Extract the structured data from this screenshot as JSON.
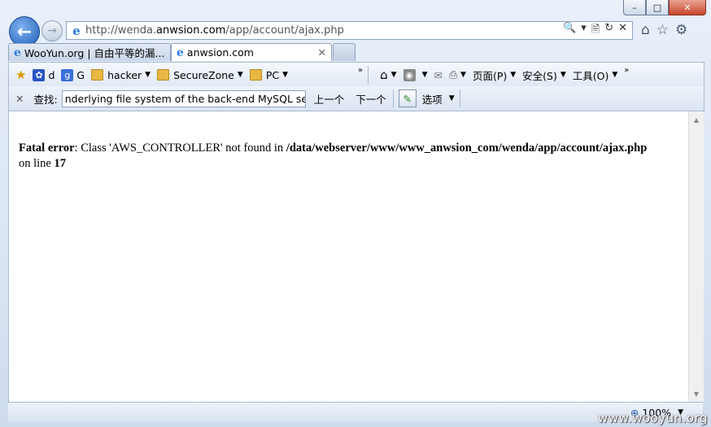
{
  "window": {
    "caption": {
      "minimize": "–",
      "maximize": "□",
      "close": "✕"
    }
  },
  "nav": {
    "back_icon": "arrow-left-icon",
    "forward_icon": "arrow-right-icon",
    "address": {
      "prefix": "http://wenda.",
      "domain": "anwsion.com",
      "path": "/app/account/ajax.php"
    },
    "address_tools": [
      "🔍",
      "▾",
      "🗎",
      "↻",
      "✕"
    ],
    "right_icons": [
      "⌂",
      "☆",
      "⚙"
    ]
  },
  "tabs": [
    {
      "label": "WooYun.org | 自由平等的漏...",
      "active": false
    },
    {
      "label": "anwsion.com",
      "active": true,
      "close": "✕"
    }
  ],
  "favorites_bar": {
    "items": [
      {
        "label": "d"
      },
      {
        "label": "G"
      },
      {
        "label": "hacker"
      },
      {
        "label": "SecureZone"
      },
      {
        "label": "PC"
      }
    ],
    "overflow": "»",
    "command_bar": {
      "page_menu": "页面(P)",
      "safety_menu": "安全(S)",
      "tools_menu": "工具(O)",
      "overflow": "»"
    }
  },
  "find_bar": {
    "close": "✕",
    "label": "查找:",
    "value": "nderlying file system of the back-end MySQL serv",
    "previous": "上一个",
    "next": "下一个",
    "options": "选项"
  },
  "page": {
    "error_label": "Fatal error",
    "error_message": ": Class 'AWS_CONTROLLER' not found in ",
    "error_path": "/data/webserver/www/www_anwsion_com/wenda/app/account/ajax.php",
    "line_text": " on line ",
    "line_number": "17"
  },
  "status_bar": {
    "zoom": "100%"
  },
  "watermark": "www.wooyun.org"
}
